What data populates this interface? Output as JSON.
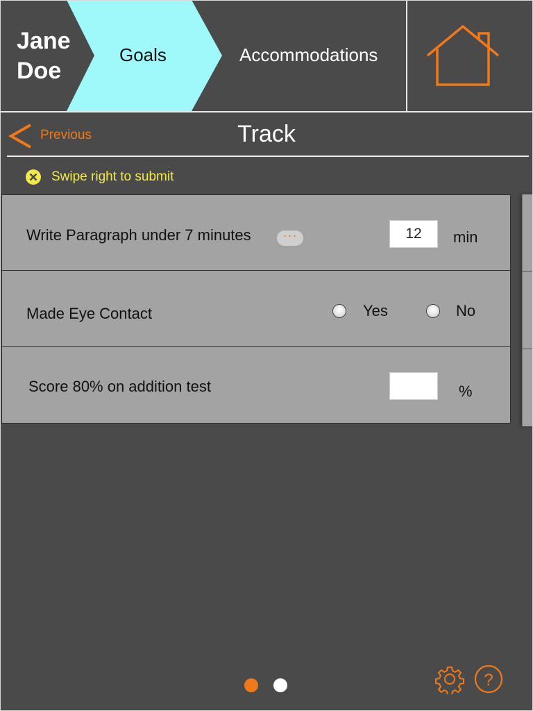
{
  "header": {
    "student_name_first": "Jane",
    "student_name_last": "Doe",
    "tabs": [
      {
        "label": "Goals",
        "active": true
      },
      {
        "label": "Accommodations",
        "active": false
      }
    ],
    "home_icon": "home-icon"
  },
  "toolbar": {
    "previous_label": "Previous",
    "title": "Track"
  },
  "notice": {
    "icon": "close-circle-icon",
    "text": "Swipe right to submit"
  },
  "goals": [
    {
      "label": "Write Paragraph under 7 minutes",
      "more_label": "···",
      "input_value": "12",
      "unit": "min"
    },
    {
      "label": "Made Eye Contact",
      "options": [
        "Yes",
        "No"
      ],
      "selected": null
    },
    {
      "label": "Score 80% on addition test",
      "input_value": "",
      "unit": "%"
    }
  ],
  "pagination": {
    "current": 1,
    "total": 2
  },
  "footer": {
    "settings_icon": "gear-icon",
    "help_icon": "help-icon"
  },
  "colors": {
    "accent": "#f07a1a",
    "active_tab": "#9ff8fa",
    "background": "#4a4a4a",
    "row": "#a3a3a3",
    "notice": "#f4e94a"
  }
}
